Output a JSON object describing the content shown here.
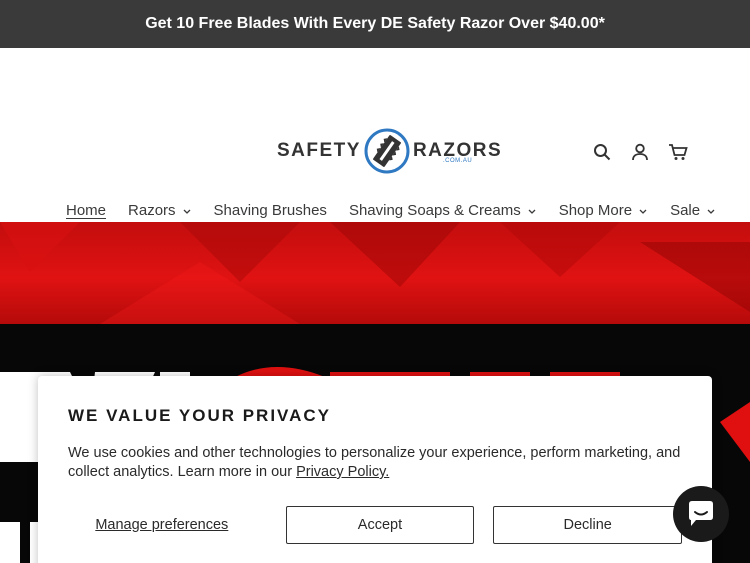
{
  "announcement": {
    "text": "Get 10 Free Blades With Every DE Safety Razor Over $40.00*"
  },
  "logo": {
    "left": "SAFETY",
    "right": "RAZORS",
    "sub": ".COM.AU"
  },
  "header_icons": [
    "search-icon",
    "account-icon",
    "cart-icon"
  ],
  "nav": {
    "items": [
      {
        "label": "Home",
        "active": true,
        "dropdown": false
      },
      {
        "label": "Razors",
        "dropdown": true
      },
      {
        "label": "Shaving Brushes",
        "dropdown": false
      },
      {
        "label": "Shaving Soaps & Creams",
        "dropdown": true
      },
      {
        "label": "Shop More",
        "dropdown": true
      },
      {
        "label": "Sale",
        "dropdown": true
      }
    ]
  },
  "consent": {
    "title": "WE VALUE YOUR PRIVACY",
    "body": "We use cookies and other technologies to personalize your experience, perform marketing, and collect analytics. Learn more in our ",
    "link": "Privacy Policy.",
    "manage_label": "Manage preferences",
    "accept_label": "Accept",
    "decline_label": "Decline"
  },
  "colors": {
    "announce_bg": "#3a3a3a",
    "hero_red": "#e01212",
    "logo_blue": "#2f79c2"
  }
}
